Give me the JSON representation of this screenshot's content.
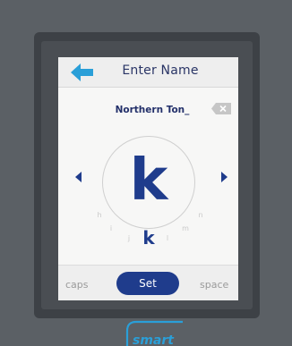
{
  "header": {
    "title": "Enter Name",
    "back_icon": "back-arrow-icon"
  },
  "input": {
    "value": "Northern Ton_",
    "backspace_icon": "backspace-icon"
  },
  "letter_wheel": {
    "selected": "k",
    "current": "k",
    "neighbors": [
      "h",
      "i",
      "j",
      "l",
      "m",
      "n"
    ]
  },
  "bottom_bar": {
    "caps_label": "caps",
    "set_label": "Set",
    "space_label": "space"
  },
  "brand": {
    "logo_text": "smart"
  },
  "colors": {
    "accent": "#1f3c8c",
    "back_arrow": "#2a9fd8",
    "device_body": "#5b6065"
  }
}
